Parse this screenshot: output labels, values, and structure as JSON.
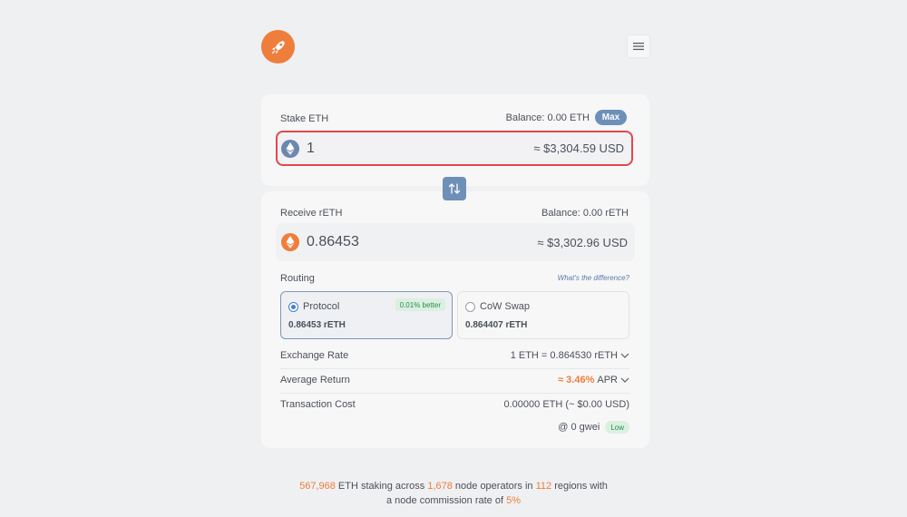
{
  "header": {
    "logo_icon": "rocket-icon",
    "menu_icon": "hamburger-menu-icon"
  },
  "stake": {
    "label": "Stake ETH",
    "balance": "Balance: 0.00 ETH",
    "max_label": "Max",
    "coin_icon": "eth-icon",
    "amount": "1",
    "usd": "≈ $3,304.59 USD"
  },
  "swap_icon": "swap-arrows-icon",
  "receive": {
    "label": "Receive rETH",
    "balance": "Balance: 0.00 rETH",
    "coin_icon": "reth-icon",
    "amount": "0.86453",
    "usd": "≈ $3,302.96 USD"
  },
  "routing": {
    "label": "Routing",
    "link": "What's the difference?",
    "options": [
      {
        "name": "Protocol",
        "value": "0.86453 rETH",
        "badge": "0.01% better",
        "selected": true
      },
      {
        "name": "CoW Swap",
        "value": "0.864407 rETH",
        "badge": "",
        "selected": false
      }
    ]
  },
  "details": {
    "exchange_rate_label": "Exchange Rate",
    "exchange_rate_value": "1 ETH = 0.864530 rETH",
    "avg_return_label": "Average Return",
    "avg_return_value": "≈ 3.46%",
    "avg_return_unit": "APR",
    "tx_cost_label": "Transaction Cost",
    "tx_cost_value": "0.00000 ETH (~ $0.00 USD)",
    "gas": "@ 0 gwei",
    "gas_badge": "Low"
  },
  "stats": {
    "eth_amount": "567,968",
    "text1": " ETH staking across ",
    "operators": "1,678",
    "text2": " node operators in ",
    "regions": "112",
    "text3": " regions with",
    "text4": "a node commission rate of ",
    "commission": "5%"
  },
  "colors": {
    "accent_orange": "#ef7d3b",
    "accent_blue": "#6e8fb8",
    "focus_red": "#e2474e",
    "success_green": "#2e8a4c"
  }
}
